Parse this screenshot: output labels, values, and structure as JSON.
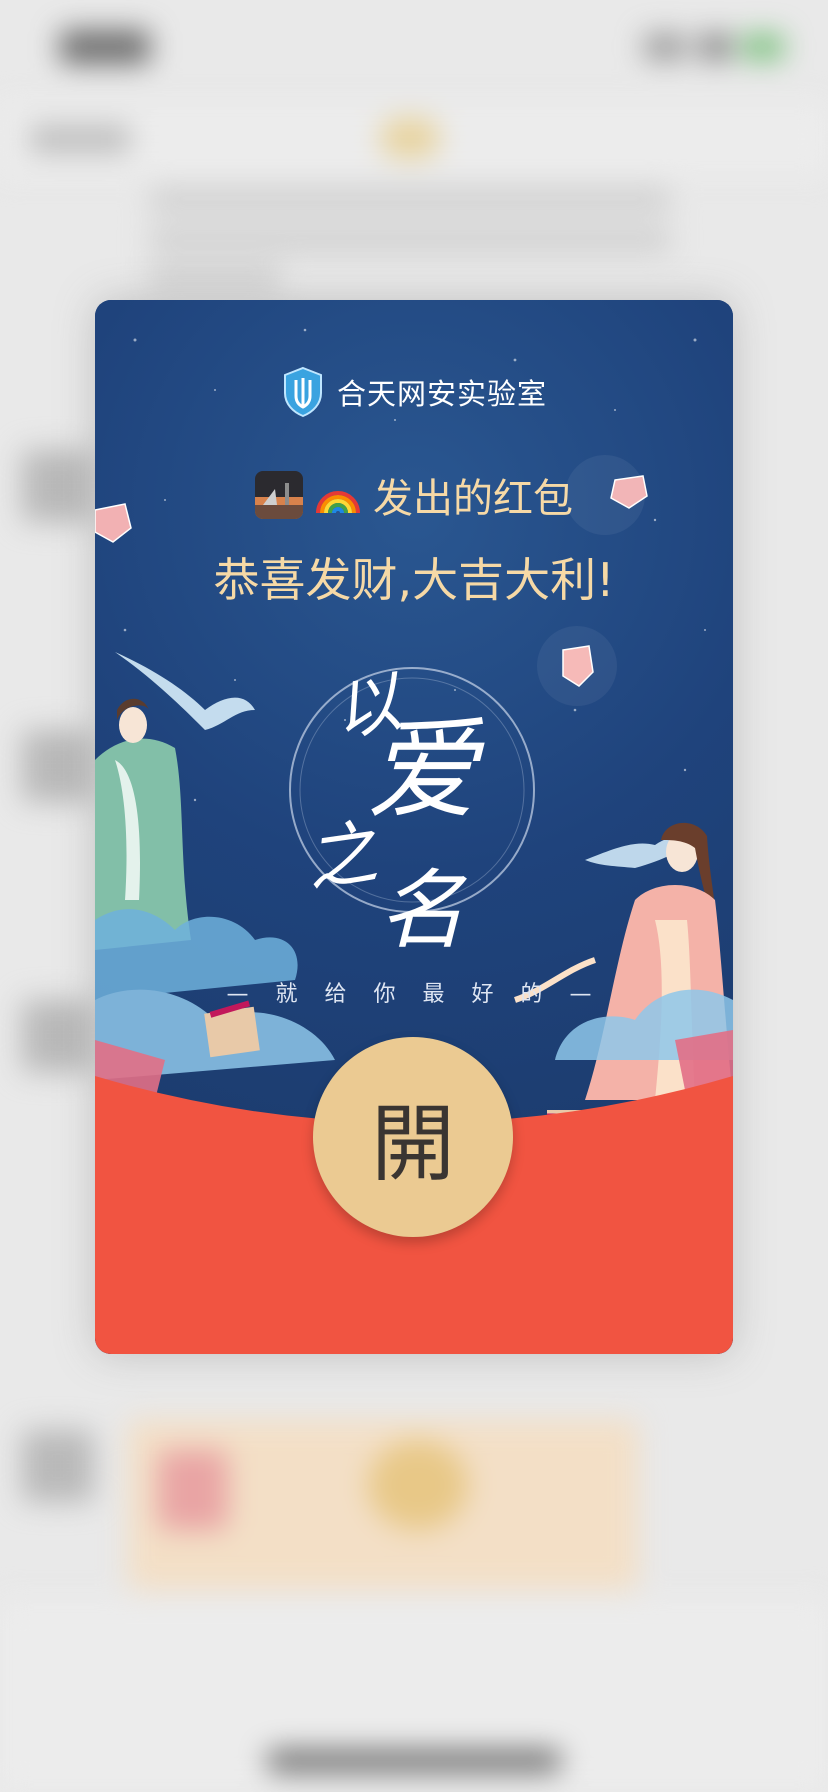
{
  "envelope": {
    "brand": "合天网安实验室",
    "sender": "发出的红包",
    "sender_emoji": "🌈",
    "greeting": "恭喜发财,大吉大利!",
    "calligraphy": [
      "以",
      "爱",
      "之",
      "名"
    ],
    "slogan": "— 就 给 你 最 好 的 —",
    "open_label": "開"
  },
  "colors": {
    "envelope_blue": "#1f3f74",
    "envelope_red": "#f15441",
    "gold_text": "#f6d9a6",
    "button_gold": "#ebca92"
  },
  "icons": {
    "brand_logo": "shield-logo-icon",
    "sender_avatar": "avatar-photo",
    "rainbow": "rainbow-emoji"
  }
}
